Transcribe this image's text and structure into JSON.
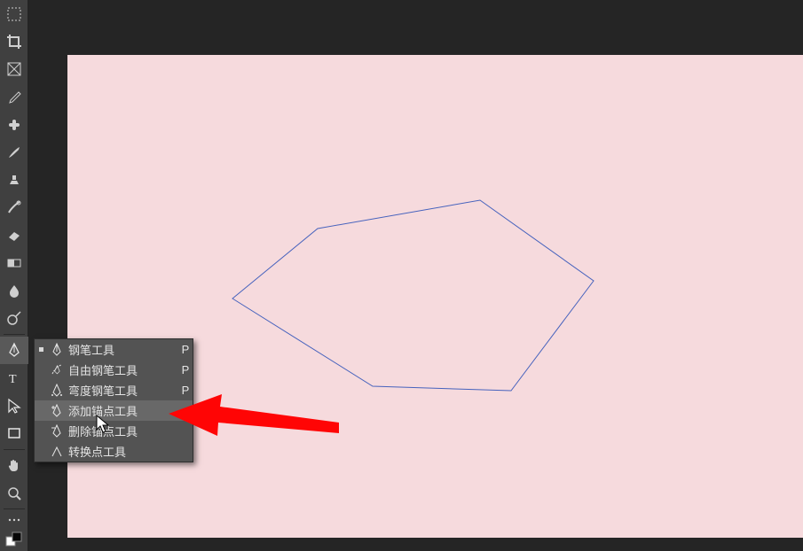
{
  "toolbar": {
    "tools": [
      {
        "name": "marquee-tool"
      },
      {
        "name": "crop-tool"
      },
      {
        "name": "frame-tool"
      },
      {
        "name": "eyedropper-tool"
      },
      {
        "name": "healing-brush-tool"
      },
      {
        "name": "brush-tool"
      },
      {
        "name": "clone-stamp-tool"
      },
      {
        "name": "history-brush-tool"
      },
      {
        "name": "eraser-tool"
      },
      {
        "name": "gradient-tool"
      },
      {
        "name": "blur-tool"
      },
      {
        "name": "dodge-tool"
      },
      {
        "name": "pen-tool"
      },
      {
        "name": "type-tool"
      },
      {
        "name": "path-selection-tool"
      },
      {
        "name": "rectangle-tool"
      },
      {
        "name": "hand-tool"
      },
      {
        "name": "zoom-tool"
      },
      {
        "name": "more-tool"
      },
      {
        "name": "swap-tool"
      }
    ]
  },
  "flyout": {
    "items": [
      {
        "label": "钢笔工具",
        "shortcut": "P",
        "icon": "pen-icon",
        "selected": true
      },
      {
        "label": "自由钢笔工具",
        "shortcut": "P",
        "icon": "free-pen-icon",
        "selected": false
      },
      {
        "label": "弯度钢笔工具",
        "shortcut": "P",
        "icon": "curvature-pen-icon",
        "selected": false
      },
      {
        "label": "添加锚点工具",
        "shortcut": "",
        "icon": "add-anchor-icon",
        "selected": false
      },
      {
        "label": "删除锚点工具",
        "shortcut": "",
        "icon": "delete-anchor-icon",
        "selected": false
      },
      {
        "label": "转换点工具",
        "shortcut": "",
        "icon": "convert-point-icon",
        "selected": false
      }
    ],
    "highlight_index": 3
  },
  "canvas": {
    "background": "#f6dadd",
    "shape_stroke": "#4662bd"
  },
  "annotation": {
    "arrow_color": "#ff0505"
  }
}
